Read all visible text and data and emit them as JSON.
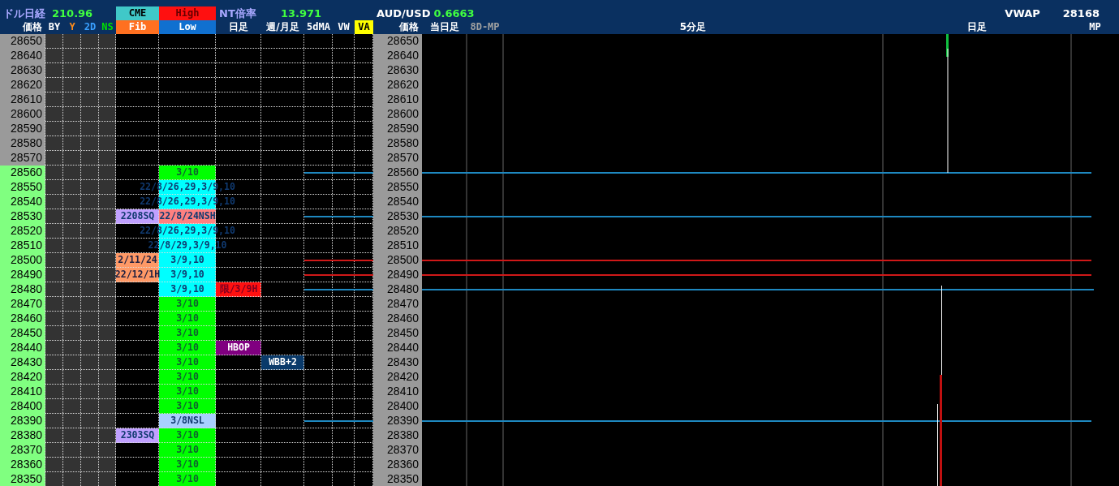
{
  "info_bar": {
    "nikkei_label": "ドル日経",
    "nikkei": "210.96",
    "cme": "CME",
    "high": "High",
    "nt_label": "NT倍率",
    "nt": "13.971",
    "aud_label": "AUD/USD",
    "aud": "0.6663",
    "vwap_label": "VWAP",
    "vwap": "28168"
  },
  "columns": [
    {
      "label": "価格",
      "color": "#ffffff"
    },
    {
      "label": "BY",
      "color": "#ffffff"
    },
    {
      "label": "Y",
      "color": "#ff8c1a"
    },
    {
      "label": "2D",
      "color": "#3aa0ff"
    },
    {
      "label": "NS",
      "color": "#00e000"
    },
    {
      "label": "Fib",
      "color": "#ff7020",
      "filled": true
    },
    {
      "label": "Low",
      "color": "#1070d0",
      "filled": true
    },
    {
      "label": "日足",
      "color": "#ffffff"
    },
    {
      "label": "週/月足",
      "color": "#ffffff"
    },
    {
      "label": "5dMA",
      "color": "#ffffff"
    },
    {
      "label": "VW",
      "color": "#ffffff"
    },
    {
      "label": "VA",
      "color": "#ffff00",
      "filled": true
    },
    {
      "label": "価格",
      "color": "#ffffff"
    }
  ],
  "chart_columns": [
    {
      "label": "当日足",
      "color": "#ffffff"
    },
    {
      "label": "8D-MP",
      "color": "#a0a0a0"
    },
    {
      "label": "5分足",
      "color": "#ffffff"
    },
    {
      "label": "日足",
      "color": "#ffffff"
    },
    {
      "label": "MP",
      "color": "#ffffff"
    }
  ],
  "rows": [
    {
      "price": "28650",
      "highlighted": false,
      "price2": "28650"
    },
    {
      "price": "28640",
      "highlighted": false,
      "price2": "28640"
    },
    {
      "price": "28630",
      "highlighted": false,
      "price2": "28630"
    },
    {
      "price": "28620",
      "highlighted": false,
      "price2": "28620"
    },
    {
      "price": "28610",
      "highlighted": false,
      "price2": "28610"
    },
    {
      "price": "28600",
      "highlighted": false,
      "price2": "28600"
    },
    {
      "price": "28590",
      "highlighted": false,
      "price2": "28590"
    },
    {
      "price": "28580",
      "highlighted": false,
      "price2": "28580"
    },
    {
      "price": "28570",
      "highlighted": false,
      "price2": "28570"
    },
    {
      "price": "28560",
      "highlighted": true,
      "price2": "28560",
      "low": {
        "text": "3/10",
        "color": "#00ff00"
      }
    },
    {
      "price": "28550",
      "highlighted": true,
      "price2": "28550",
      "low": {
        "text": "22/8/26,29,3/9,10",
        "color": "#00ffff"
      }
    },
    {
      "price": "28540",
      "highlighted": true,
      "price2": "28540",
      "low": {
        "text": "22/8/26,29,3/9,10",
        "color": "#00ffff"
      }
    },
    {
      "price": "28530",
      "highlighted": true,
      "price2": "28530",
      "fib": {
        "text": "2208SQ",
        "color": "#c0a0ff"
      },
      "low": {
        "text": "22/8/24NSH",
        "color": "#ff8080"
      }
    },
    {
      "price": "28520",
      "highlighted": true,
      "price2": "28520",
      "low": {
        "text": "22/8/26,29,3/9,10",
        "color": "#00ffff"
      }
    },
    {
      "price": "28510",
      "highlighted": true,
      "price2": "28510",
      "low": {
        "text": "22/8/29,3/9,10",
        "color": "#00ffff"
      }
    },
    {
      "price": "28500",
      "highlighted": true,
      "price2": "28500",
      "fib": {
        "text": "2/11/24",
        "color": "#ff9966"
      },
      "low": {
        "text": "3/9,10",
        "color": "#00ffff"
      }
    },
    {
      "price": "28490",
      "highlighted": true,
      "price2": "28490",
      "fib": {
        "text": "22/12/1H",
        "color": "#ff9966"
      },
      "low": {
        "text": "3/9,10",
        "color": "#00ffff"
      }
    },
    {
      "price": "28480",
      "highlighted": true,
      "price2": "28480",
      "low": {
        "text": "3/9,10",
        "color": "#00ffff"
      },
      "daily": {
        "text": "限/3/9H",
        "color": "#ff1010"
      }
    },
    {
      "price": "28470",
      "highlighted": true,
      "price2": "28470",
      "low": {
        "text": "3/10",
        "color": "#00ff00"
      }
    },
    {
      "price": "28460",
      "highlighted": true,
      "price2": "28460",
      "low": {
        "text": "3/10",
        "color": "#00ff00"
      }
    },
    {
      "price": "28450",
      "highlighted": true,
      "price2": "28450",
      "low": {
        "text": "3/10",
        "color": "#00ff00"
      }
    },
    {
      "price": "28440",
      "highlighted": true,
      "price2": "28440",
      "low": {
        "text": "3/10",
        "color": "#00ff00"
      },
      "daily": {
        "text": "HBOP",
        "color": "#800080"
      }
    },
    {
      "price": "28430",
      "highlighted": true,
      "price2": "28430",
      "low": {
        "text": "3/10",
        "color": "#00ff00"
      },
      "weekly": {
        "text": "WBB+2",
        "color": "#0a3a6a"
      }
    },
    {
      "price": "28420",
      "highlighted": true,
      "price2": "28420",
      "low": {
        "text": "3/10",
        "color": "#00ff00"
      }
    },
    {
      "price": "28410",
      "highlighted": true,
      "price2": "28410",
      "low": {
        "text": "3/10",
        "color": "#00ff00"
      }
    },
    {
      "price": "28400",
      "highlighted": true,
      "price2": "28400",
      "low": {
        "text": "3/10",
        "color": "#00ff00"
      }
    },
    {
      "price": "28390",
      "highlighted": true,
      "price2": "28390",
      "low": {
        "text": "3/8NSL",
        "color": "#a8d0ff"
      }
    },
    {
      "price": "28380",
      "highlighted": true,
      "price2": "28380",
      "fib": {
        "text": "2303SQ",
        "color": "#c0a0ff"
      },
      "low": {
        "text": "3/10",
        "color": "#00ff00"
      }
    },
    {
      "price": "28370",
      "highlighted": true,
      "price2": "28370",
      "low": {
        "text": "3/10",
        "color": "#00ff00"
      }
    },
    {
      "price": "28360",
      "highlighted": true,
      "price2": "28360",
      "low": {
        "text": "3/10",
        "color": "#00ff00"
      }
    },
    {
      "price": "28350",
      "highlighted": true,
      "price2": "28350",
      "low": {
        "text": "3/10",
        "color": "#00ff00"
      }
    }
  ]
}
